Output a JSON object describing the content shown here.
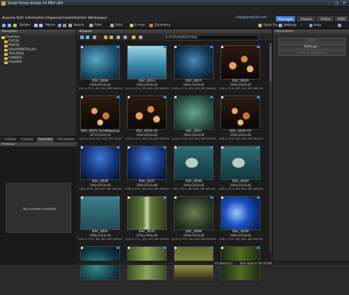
{
  "window": {
    "title": "Zoner Photo Studio 14 PRO x64",
    "minimize": "–",
    "maximize": "□",
    "close": "✕"
  },
  "menu": {
    "items": [
      "Acquire",
      "Edit",
      "Information",
      "Organize",
      "Create",
      "Publish",
      "Workspace"
    ],
    "email": "info@tipotai3d.com",
    "modes": [
      "Manager",
      "Viewer",
      "Editor",
      "RAW"
    ],
    "active_mode": "Manager"
  },
  "toolbar": {
    "rotate": "Rotate:",
    "panes": "Panes:",
    "search": "Search",
    "filter": "Filter",
    "print": "Print",
    "email": "E-mail",
    "zoner": "Zonerama",
    "quickfix": "Quick Fix",
    "settings": "Settings",
    "help": "Help"
  },
  "navigator": {
    "title": "Navigator",
    "root": "Favorites",
    "items": [
      "FOTOS",
      "PERITS",
      "SALVAPANTALLAS",
      "TALLERES",
      "FONDOS",
      "GALERIA"
    ]
  },
  "left_tabs": [
    "Folders",
    "Catalog",
    "Favorites",
    "Zonerama"
  ],
  "preview": {
    "title": "Preview",
    "text": "No preview available"
  },
  "browser": {
    "title": "Browser",
    "path": "D:\\FOTOS\\PERITO\\tb",
    "thumbs": [
      {
        "name": "DSC_0008",
        "dims": "3984x2656x48",
        "info": "1/30 s, F3.5, ISO 100, DPI 300.00",
        "img": "img-aquarium"
      },
      {
        "name": "DSC_0013",
        "dims": "3984x2656x48",
        "info": "1/15 s, F3.5, ISO 400, DPI 300.00",
        "img": "img-shark"
      },
      {
        "name": "DSC_0015",
        "dims": "3984x2656x48",
        "info": "1/30 s, F3.5, ISO 400, DPI 300.00",
        "img": "img-fish-school"
      },
      {
        "name": "DSC_0029",
        "dims": "3984x2656x48",
        "info": "1/15 s, F5.6, ISO 100, DPI 300.00",
        "img": "img-orange"
      },
      {
        "name": "DSC_0029_ToneMapping",
        "dims": "3872x2592x24",
        "info": "1/15 s, F5.6, ISO 100, DPI 72.00",
        "img": "img-orange2"
      },
      {
        "name": "DSC_0033 (2)",
        "dims": "3984x2656x48",
        "info": "1/15 s, F4.2, ISO 100, DPI 300.00",
        "img": "img-orange"
      },
      {
        "name": "DSC_0033",
        "dims": "3984x2656x48",
        "info": "1/15 s, F3.5, ISO 400, DPI 300.00",
        "img": "img-green"
      },
      {
        "name": "DSC_0034 (2)",
        "dims": "3984x2656x48",
        "info": "1/15 s, F5.6, ISO 100, DPI 300.00",
        "img": "img-orange2"
      },
      {
        "name": "DSC_0036",
        "dims": "3984x2656x48",
        "info": "1/8 s, F3.5, ISO 200, DPI 300.00",
        "img": "img-blue"
      },
      {
        "name": "DSC_0037",
        "dims": "3984x2656x48",
        "info": "1/30 s, F3.5, ISO 400, DPI 300.00",
        "img": "img-blue"
      },
      {
        "name": "DSC_0038",
        "dims": "3984x2656x48",
        "info": "1/8 s, F3.5, ISO 400, DPI 300.00",
        "img": "img-sunfish"
      },
      {
        "name": "DSC_0040",
        "dims": "3984x2656x48",
        "info": "1/30 s, F3.5, ISO 400, DPI 300.00",
        "img": "img-sunfish"
      },
      {
        "name": "DSC_0041",
        "dims": "3984x2656x48",
        "info": "1/15 s, F3.5, ISO 400, DPI 300.00",
        "img": "img-shark2"
      },
      {
        "name": "DSC_0042",
        "dims": "2656x3984x48",
        "info": "1/15 s, F3.5, ISO 200, DPI 300.00",
        "img": "img-waterfall"
      },
      {
        "name": "DSC_0048",
        "dims": "3984x2656x48",
        "info": "1/15 s, F3.5, ISO 400, DPI 300.00",
        "img": "img-lobster"
      },
      {
        "name": "DSC_0049",
        "dims": "3984x2656x48",
        "info": "1/15 s, F3.5, ISO 400, DPI 300.00",
        "img": "img-jelly"
      },
      {
        "name": "",
        "dims": "",
        "info": "",
        "img": "img-turtle"
      },
      {
        "name": "",
        "dims": "",
        "info": "",
        "img": "img-forest"
      },
      {
        "name": "",
        "dims": "",
        "info": "",
        "img": "img-moss"
      },
      {
        "name": "",
        "dims": "",
        "info": "",
        "img": "img-reeds"
      }
    ]
  },
  "information": {
    "title": "Information",
    "buttons": [
      "Save",
      "Settings...",
      "Copy to Clipboard"
    ]
  },
  "status": {
    "left": "35 objects(1)",
    "right": "Total objects: 80.70 MB"
  }
}
